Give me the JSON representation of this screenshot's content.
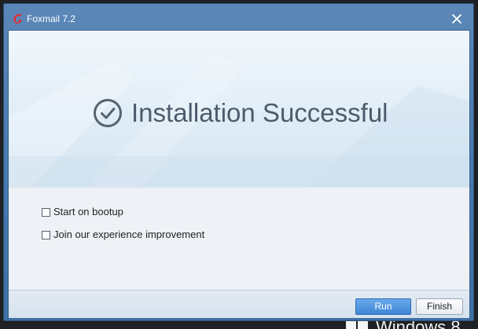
{
  "window": {
    "title": "Foxmail 7.2"
  },
  "icons": {
    "app": "foxmail-logo-icon",
    "close": "close-icon",
    "success": "check-circle-icon",
    "os": "windows-logo-icon"
  },
  "banner": {
    "title": "Installation Successful"
  },
  "options": [
    {
      "label": "Start on bootup",
      "checked": false
    },
    {
      "label": "Join our experience improvement",
      "checked": false
    }
  ],
  "buttons": {
    "run": "Run",
    "finish": "Finish"
  },
  "desktop": {
    "os_text": "Windows 8"
  },
  "colors": {
    "accent": "#3f86d6",
    "titlebar": "#4678ad",
    "title_text": "#4c5b6b",
    "app_icon": "#e0302c"
  }
}
